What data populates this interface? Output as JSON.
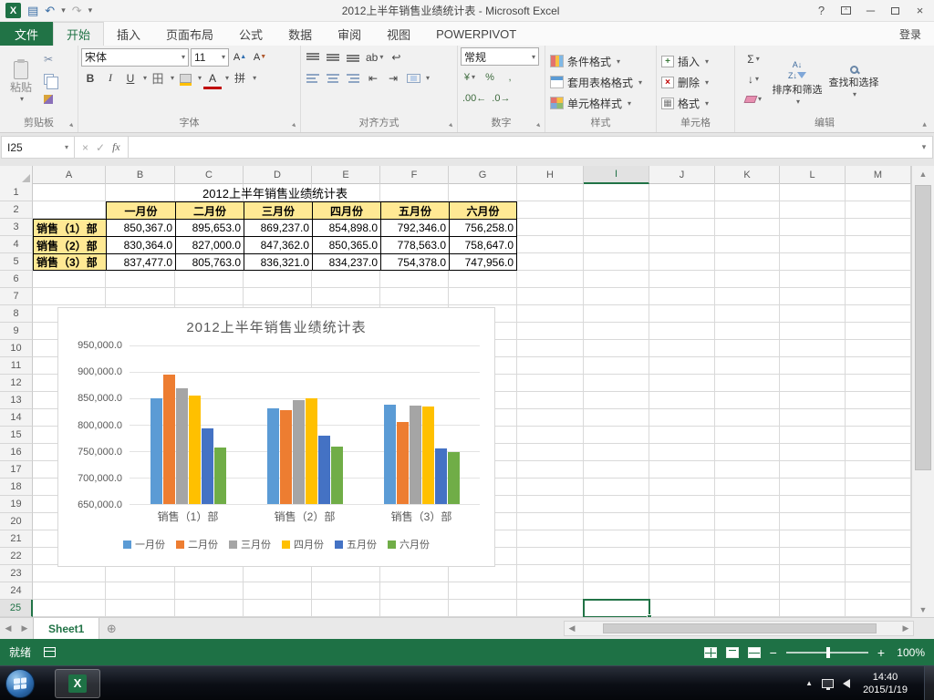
{
  "window": {
    "title": "2012上半年销售业绩统计表 - Microsoft Excel",
    "help": "?"
  },
  "tabs": {
    "file": "文件",
    "items": [
      "开始",
      "插入",
      "页面布局",
      "公式",
      "数据",
      "审阅",
      "视图",
      "POWERPIVOT"
    ],
    "active": "开始",
    "sign_in": "登录"
  },
  "ribbon": {
    "clipboard": {
      "label": "剪贴板",
      "paste": "粘贴"
    },
    "font": {
      "label": "字体",
      "font_name": "宋体",
      "font_size": "11",
      "bold": "B",
      "italic": "I",
      "underline": "U",
      "grow": "A",
      "shrink": "A"
    },
    "alignment": {
      "label": "对齐方式",
      "orientation": "ab"
    },
    "number": {
      "label": "数字",
      "format": "常规",
      "currency": "¥",
      "percent": "%",
      "comma": ",",
      "inc_dec": ".00",
      "dec_dec": ".0"
    },
    "styles": {
      "label": "样式",
      "items": [
        "条件格式",
        "套用表格格式",
        "单元格样式"
      ]
    },
    "cells": {
      "label": "单元格",
      "items": [
        "插入",
        "删除",
        "格式"
      ]
    },
    "editing": {
      "label": "编辑",
      "autosum": "Σ",
      "sort": "排序和筛选",
      "find": "查找和选择"
    }
  },
  "formula_bar": {
    "name_box": "I25",
    "formula": "",
    "fx": "fx"
  },
  "sheet": {
    "columns": [
      "A",
      "B",
      "C",
      "D",
      "E",
      "F",
      "G",
      "H",
      "I",
      "J",
      "K",
      "L",
      "M"
    ],
    "row_count": 25,
    "selected_cell": "I25",
    "selected_col": "I",
    "selected_row": 25,
    "table": {
      "title": "2012上半年销售业绩统计表",
      "col_headers": [
        "一月份",
        "二月份",
        "三月份",
        "四月份",
        "五月份",
        "六月份"
      ],
      "rows": [
        {
          "label": "销售（1）部",
          "values": [
            "850,367.0",
            "895,653.0",
            "869,237.0",
            "854,898.0",
            "792,346.0",
            "756,258.0"
          ]
        },
        {
          "label": "销售（2）部",
          "values": [
            "830,364.0",
            "827,000.0",
            "847,362.0",
            "850,365.0",
            "778,563.0",
            "758,647.0"
          ]
        },
        {
          "label": "销售（3）部",
          "values": [
            "837,477.0",
            "805,763.0",
            "836,321.0",
            "834,237.0",
            "754,378.0",
            "747,956.0"
          ]
        }
      ],
      "header_fill": "#FFE994"
    }
  },
  "chart_data": {
    "type": "bar",
    "title": "2012上半年销售业绩统计表",
    "categories": [
      "销售（1）部",
      "销售（2）部",
      "销售（3）部"
    ],
    "series": [
      {
        "name": "一月份",
        "color": "#5B9BD5",
        "values": [
          850367,
          830364,
          837477
        ]
      },
      {
        "name": "二月份",
        "color": "#ED7D31",
        "values": [
          895653,
          827000,
          805763
        ]
      },
      {
        "name": "三月份",
        "color": "#A5A5A5",
        "values": [
          869237,
          847362,
          836321
        ]
      },
      {
        "name": "四月份",
        "color": "#FFC000",
        "values": [
          854898,
          850365,
          834237
        ]
      },
      {
        "name": "五月份",
        "color": "#4472C4",
        "values": [
          792346,
          778563,
          754378
        ]
      },
      {
        "name": "六月份",
        "color": "#70AD47",
        "values": [
          756258,
          758647,
          747956
        ]
      }
    ],
    "ylim": [
      650000,
      950000
    ],
    "yticks": [
      "950,000.0",
      "900,000.0",
      "850,000.0",
      "800,000.0",
      "750,000.0",
      "700,000.0",
      "650,000.0"
    ],
    "legend_position": "bottom",
    "grid": true
  },
  "sheet_tabs": {
    "active": "Sheet1"
  },
  "status_bar": {
    "ready": "就绪",
    "zoom": "100%"
  },
  "taskbar": {
    "time": "14:40",
    "date": "2015/1/19"
  }
}
